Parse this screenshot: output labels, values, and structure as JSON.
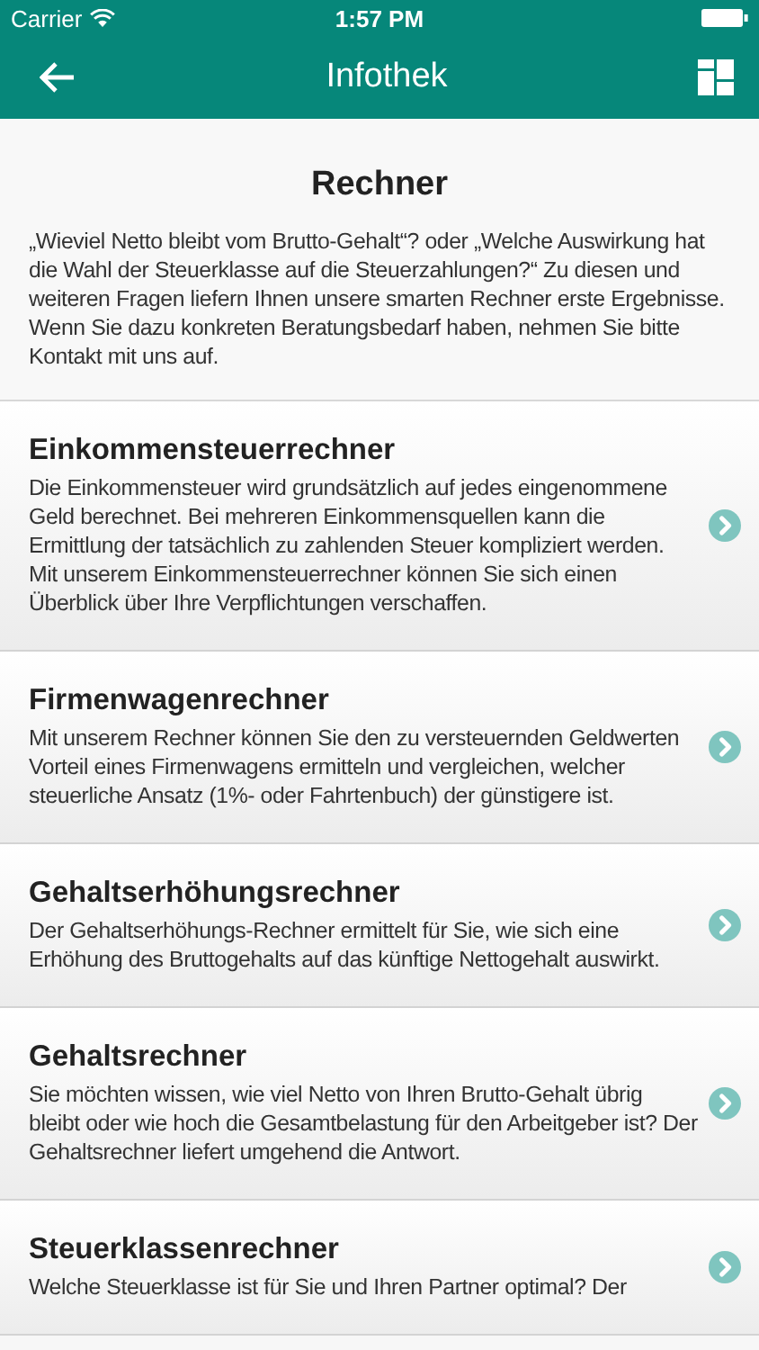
{
  "status_bar": {
    "carrier": "Carrier",
    "time": "1:57 PM"
  },
  "nav_bar": {
    "title": "Infothek"
  },
  "intro": {
    "title": "Rechner",
    "text": "„Wieviel Netto bleibt vom Brutto-Gehalt“? oder „Welche Auswirkung hat die Wahl der Steuerklasse auf die Steuerzahlungen?“ Zu diesen und weiteren Fragen liefern Ihnen unsere smarten Rechner erste Ergebnisse. Wenn Sie dazu konkreten Beratungsbedarf haben, nehmen Sie bitte Kontakt mit uns auf."
  },
  "items": [
    {
      "title": "Einkommensteuerrechner",
      "text": "Die Einkommensteuer wird grundsätzlich auf jedes eingenommene Geld berechnet. Bei mehreren Einkommensquellen kann die Ermittlung der tatsächlich zu zahlenden Steuer kompliziert werden. Mit unserem Einkommensteuerrechner können Sie sich einen Überblick über Ihre Verpflichtungen verschaffen."
    },
    {
      "title": "Firmenwagenrechner",
      "text": "Mit unserem Rechner können Sie den zu versteuernden Geldwerten Vorteil eines Firmenwagens ermitteln und vergleichen, welcher steuerliche Ansatz (1%- oder Fahrtenbuch) der günstigere ist."
    },
    {
      "title": "Gehaltserhöhungsrechner",
      "text": "Der Gehaltserhöhungs-Rechner ermittelt für Sie, wie sich eine Erhöhung des Bruttogehalts auf das künftige Nettogehalt auswirkt."
    },
    {
      "title": "Gehaltsrechner",
      "text": "Sie möchten wissen, wie viel Netto von Ihren Brutto-Gehalt übrig bleibt oder wie hoch die Gesamtbelastung für den Arbeitgeber ist? Der Gehaltsrechner liefert umgehend die Antwort."
    },
    {
      "title": "Steuerklassenrechner",
      "text": "Welche Steuerklasse ist für Sie und Ihren Partner optimal? Der"
    }
  ]
}
